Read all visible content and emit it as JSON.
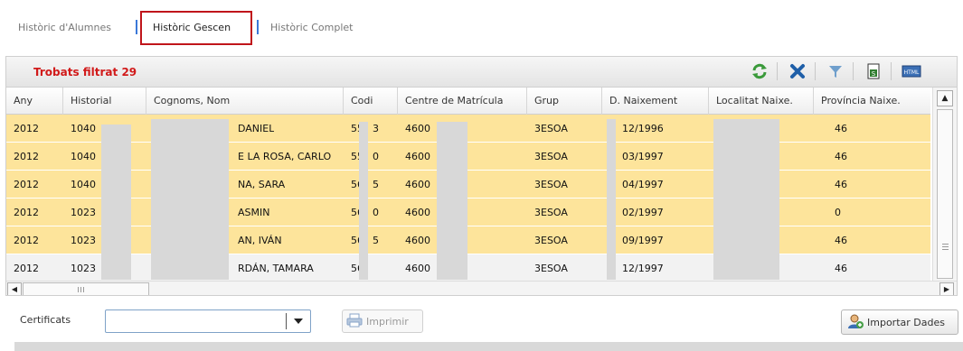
{
  "tabs": [
    {
      "label": "Històric d'Alumnes",
      "active": false
    },
    {
      "label": "Històric Gescen",
      "active": true
    },
    {
      "label": "Històric Complet",
      "active": false
    }
  ],
  "toolbar": {
    "filter_text": "Trobats filtrat 29",
    "icons": [
      "refresh-icon",
      "clear-filter-icon",
      "filter-icon",
      "excel-export-icon",
      "html-export-icon"
    ],
    "colors": {
      "refresh": "#3a9a3a",
      "clear": "#1f5fa8",
      "filter": "#6f9fcc",
      "excel": "#2f7d2f",
      "accent": "#d11a1a"
    }
  },
  "grid": {
    "columns": [
      "Any",
      "Historial",
      "Cognoms, Nom",
      "Codi",
      "Centre de Matrícula",
      "Grup",
      "D. Naixement",
      "Localitat Naixe.",
      "Província Naixe."
    ],
    "rows": [
      {
        "any": "2012",
        "historial": "1040",
        "nom": "DANIEL",
        "codi": "55",
        "codi2": "3",
        "centre": "4600",
        "grup": "3ESOA",
        "naixement": "12/1996",
        "provincia": "46",
        "selected": true
      },
      {
        "any": "2012",
        "historial": "1040",
        "nom": "E LA ROSA, CARLO",
        "codi": "55",
        "codi2": "0",
        "centre": "4600",
        "grup": "3ESOA",
        "naixement": "03/1997",
        "provincia": "46",
        "selected": true
      },
      {
        "any": "2012",
        "historial": "1040",
        "nom": "NA, SARA",
        "codi": "56",
        "codi2": "5",
        "centre": "4600",
        "grup": "3ESOA",
        "naixement": "04/1997",
        "provincia": "46",
        "selected": true
      },
      {
        "any": "2012",
        "historial": "1023",
        "nom": "ASMIN",
        "codi": "56",
        "codi2": "0",
        "centre": "4600",
        "grup": "3ESOA",
        "naixement": "02/1997",
        "provincia": "0",
        "selected": true
      },
      {
        "any": "2012",
        "historial": "1023",
        "nom": "AN, IVÁN",
        "codi": "56",
        "codi2": "5",
        "centre": "4600",
        "grup": "3ESOA",
        "naixement": "09/1997",
        "provincia": "46",
        "selected": true
      },
      {
        "any": "2012",
        "historial": "1023",
        "nom": "RDÁN, TAMARA",
        "codi": "56",
        "codi2": "",
        "centre": "4600",
        "grup": "3ESOA",
        "naixement": "12/1997",
        "provincia": "46",
        "selected": false
      }
    ]
  },
  "bottom": {
    "certificats_label": "Certificats",
    "certificats_value": "",
    "print_label": "Imprimir",
    "import_label": "Importar Dades"
  }
}
